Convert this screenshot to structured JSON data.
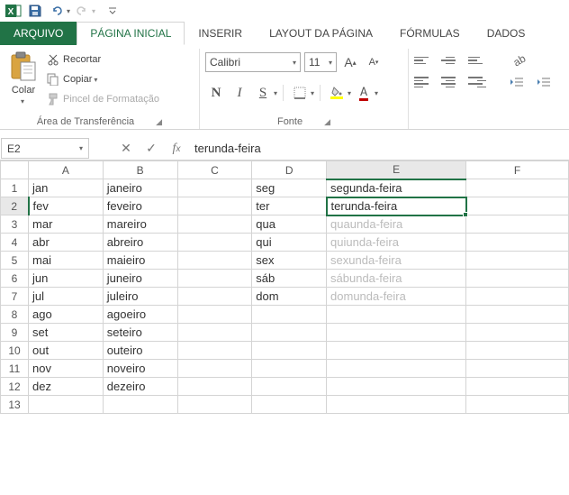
{
  "qat": {
    "save": "Save",
    "undo": "Undo",
    "redo": "Redo"
  },
  "tabs": {
    "file": "ARQUIVO",
    "items": [
      "PÁGINA INICIAL",
      "INSERIR",
      "LAYOUT DA PÁGINA",
      "FÓRMULAS",
      "DADOS"
    ],
    "active": 0
  },
  "ribbon": {
    "clipboard": {
      "paste": "Colar",
      "cut": "Recortar",
      "copy": "Copiar",
      "format_painter": "Pincel de Formatação",
      "group_label": "Área de Transferência"
    },
    "font": {
      "name": "Calibri",
      "size": "11",
      "group_label": "Fonte",
      "bold": "N",
      "italic": "I",
      "underline": "S",
      "color_letter": "A"
    },
    "alignment": {
      "group_label": ""
    }
  },
  "formula": {
    "name_box": "E2",
    "value": "terunda-feira"
  },
  "grid": {
    "columns": [
      "A",
      "B",
      "C",
      "D",
      "E",
      "F"
    ],
    "active_col": 4,
    "active_row": 1,
    "rows": [
      {
        "n": "1",
        "A": "jan",
        "B": "janeiro",
        "C": "",
        "D": "seg",
        "E": "segunda-feira",
        "ghost": false
      },
      {
        "n": "2",
        "A": "fev",
        "B": "feveiro",
        "C": "",
        "D": "ter",
        "E": "terunda-feira",
        "ghost": false
      },
      {
        "n": "3",
        "A": "mar",
        "B": "mareiro",
        "C": "",
        "D": "qua",
        "E": "quaunda-feira",
        "ghost": true
      },
      {
        "n": "4",
        "A": "abr",
        "B": "abreiro",
        "C": "",
        "D": "qui",
        "E": "quiunda-feira",
        "ghost": true
      },
      {
        "n": "5",
        "A": "mai",
        "B": "maieiro",
        "C": "",
        "D": "sex",
        "E": "sexunda-feira",
        "ghost": true
      },
      {
        "n": "6",
        "A": "jun",
        "B": "juneiro",
        "C": "",
        "D": "sáb",
        "E": "sábunda-feira",
        "ghost": true
      },
      {
        "n": "7",
        "A": "jul",
        "B": "juleiro",
        "C": "",
        "D": "dom",
        "E": "domunda-feira",
        "ghost": true
      },
      {
        "n": "8",
        "A": "ago",
        "B": "agoeiro",
        "C": "",
        "D": "",
        "E": "",
        "ghost": false
      },
      {
        "n": "9",
        "A": "set",
        "B": "seteiro",
        "C": "",
        "D": "",
        "E": "",
        "ghost": false
      },
      {
        "n": "10",
        "A": "out",
        "B": "outeiro",
        "C": "",
        "D": "",
        "E": "",
        "ghost": false
      },
      {
        "n": "11",
        "A": "nov",
        "B": "noveiro",
        "C": "",
        "D": "",
        "E": "",
        "ghost": false
      },
      {
        "n": "12",
        "A": "dez",
        "B": "dezeiro",
        "C": "",
        "D": "",
        "E": "",
        "ghost": false
      },
      {
        "n": "13",
        "A": "",
        "B": "",
        "C": "",
        "D": "",
        "E": "",
        "ghost": false
      }
    ]
  }
}
